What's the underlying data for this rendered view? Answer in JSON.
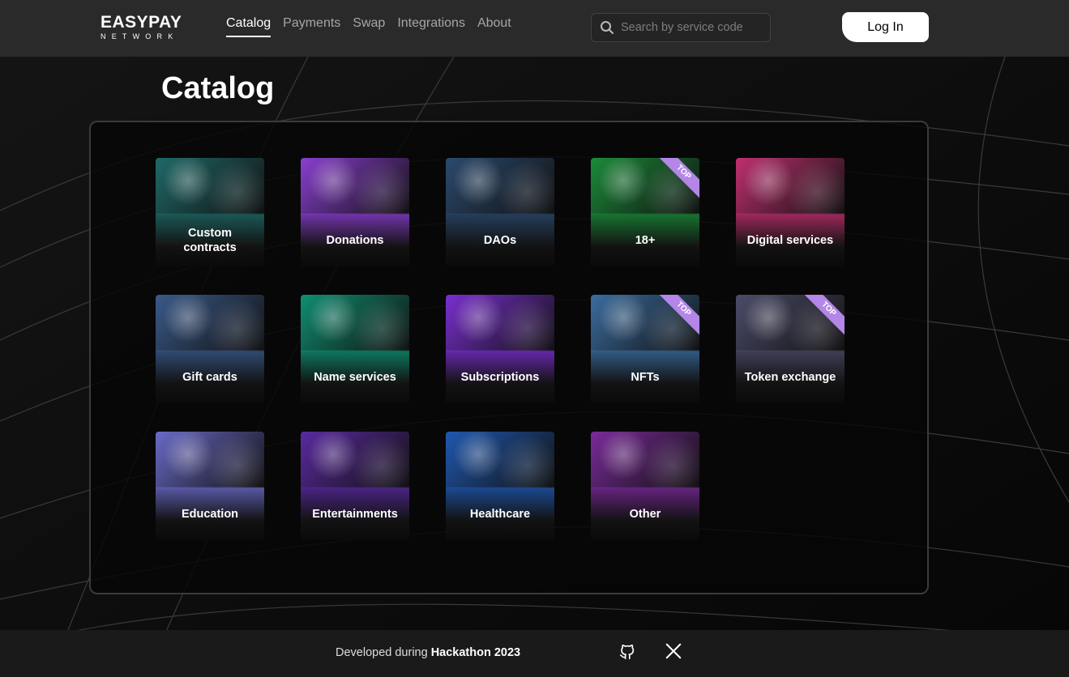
{
  "brand": {
    "name": "EASYPAY",
    "sub": "NETWORK"
  },
  "nav": [
    {
      "label": "Catalog",
      "active": true
    },
    {
      "label": "Payments",
      "active": false
    },
    {
      "label": "Swap",
      "active": false
    },
    {
      "label": "Integrations",
      "active": false
    },
    {
      "label": "About",
      "active": false
    }
  ],
  "search": {
    "placeholder": "Search by service code",
    "icon": "search-icon"
  },
  "login_label": "Log In",
  "page_title": "Catalog",
  "categories": [
    {
      "label": "Custom contracts",
      "top": false,
      "accent": "#1f6a68",
      "image": "gears"
    },
    {
      "label": "Donations",
      "top": false,
      "accent": "#8a3fd0",
      "image": "coins"
    },
    {
      "label": "DAOs",
      "top": false,
      "accent": "#2b4a6e",
      "image": "cubes-network"
    },
    {
      "label": "18+",
      "top": true,
      "accent": "#1b8c3a",
      "image": "leaves"
    },
    {
      "label": "Digital services",
      "top": false,
      "accent": "#c0306f",
      "image": "vr-headset"
    },
    {
      "label": "Gift cards",
      "top": false,
      "accent": "#3a5a8a",
      "image": "gift-cards"
    },
    {
      "label": "Name services",
      "top": false,
      "accent": "#0f8f72",
      "image": "name-tags"
    },
    {
      "label": "Subscriptions",
      "top": false,
      "accent": "#7a2fd0",
      "image": "subscribe-button"
    },
    {
      "label": "NFTs",
      "top": true,
      "accent": "#3b6da0",
      "image": "ape"
    },
    {
      "label": "Token exchange",
      "top": true,
      "accent": "#4c4c6a",
      "image": "crypto-coins"
    },
    {
      "label": "Education",
      "top": false,
      "accent": "#6a6ac8",
      "image": "book-pencil"
    },
    {
      "label": "Entertainments",
      "top": false,
      "accent": "#5a2aa0",
      "image": "concert"
    },
    {
      "label": "Healthcare",
      "top": false,
      "accent": "#1f58b0",
      "image": "medical-folder"
    },
    {
      "label": "Other",
      "top": false,
      "accent": "#7a2a9a",
      "image": "spheres"
    }
  ],
  "badge_text": "TOP",
  "footer": {
    "prefix": "Developed during ",
    "event": "Hackathon 2023"
  },
  "social": [
    "github-icon",
    "x-icon"
  ]
}
